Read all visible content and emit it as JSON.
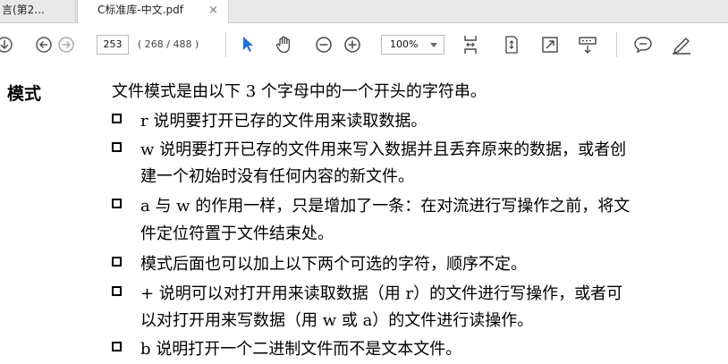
{
  "tabs": [
    {
      "label": "言(第2..."
    },
    {
      "label": "C标准库-中文.pdf",
      "close": "×"
    }
  ],
  "toolbar": {
    "page_current": "253",
    "page_count": "( 268 / 488 )",
    "zoom": "100%"
  },
  "document": {
    "heading": "模式",
    "intro": "文件模式是由以下 3 个字母中的一个开头的字符串。",
    "lines": [
      "r 说明要打开已存的文件用来读取数据。",
      "w 说明要打开已存的文件用来写入数据并且丢弃原来的数据，或者创",
      "建一个初始时没有任何内容的新文件。",
      "a 与 w 的作用一样，只是增加了一条：在对流进行写操作之前，将文",
      "件定位符置于文件结束处。",
      "模式后面也可以加上以下两个可选的字符，顺序不定。",
      "+ 说明可以对打开用来读取数据（用 r）的文件进行写操作，或者可",
      "以对打开用来写数据（用 w 或 a）的文件进行读操作。",
      "b 说明打开一个二进制文件而不是文本文件。"
    ]
  }
}
